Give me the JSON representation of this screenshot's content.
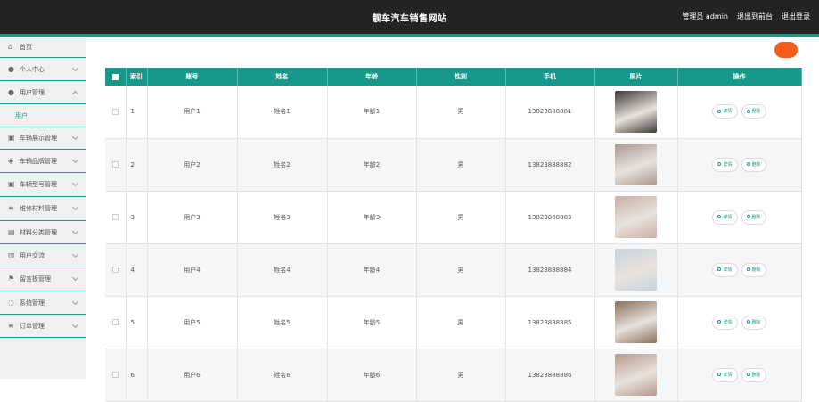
{
  "header": {
    "title": "靓车汽车销售网站",
    "admin_label": "管理员 admin",
    "backend_label": "退出到前台",
    "logout_label": "退出登录"
  },
  "sidebar": {
    "items": [
      {
        "label": "首页",
        "icon": "home-icon",
        "expanded": false,
        "has_chevron": false
      },
      {
        "label": "个人中心",
        "icon": "user-icon",
        "has_chevron": true
      },
      {
        "label": "用户管理",
        "icon": "user-icon",
        "has_chevron": true,
        "expanded": true
      },
      {
        "label": "车辆展示管理",
        "icon": "car-icon",
        "has_chevron": true
      },
      {
        "label": "车辆品牌管理",
        "icon": "tag-icon",
        "has_chevron": true
      },
      {
        "label": "车辆型号管理",
        "icon": "car-icon",
        "has_chevron": true
      },
      {
        "label": "维修材料管理",
        "icon": "list-icon",
        "has_chevron": true
      },
      {
        "label": "材料分类管理",
        "icon": "box-icon",
        "has_chevron": true
      },
      {
        "label": "用户交流",
        "icon": "chat-icon",
        "has_chevron": true
      },
      {
        "label": "留言板管理",
        "icon": "flag-icon",
        "has_chevron": true
      },
      {
        "label": "系统管理",
        "icon": "gear-icon",
        "has_chevron": true
      },
      {
        "label": "订单管理",
        "icon": "list-icon",
        "has_chevron": true
      }
    ],
    "sub_item": "用户"
  },
  "toolbar": {
    "orange_button_label": " "
  },
  "table": {
    "headers": [
      "",
      "索引",
      "账号",
      "姓名",
      "年龄",
      "性别",
      "手机",
      "照片",
      "操作"
    ],
    "rows": [
      {
        "index": "1",
        "account": "用户1",
        "name": "姓名1",
        "age": "年龄1",
        "gender": "男",
        "phone": "13823888881",
        "photo_color": "#3b3a36"
      },
      {
        "index": "2",
        "account": "用户2",
        "name": "姓名2",
        "age": "年龄2",
        "gender": "男",
        "phone": "13823888882",
        "photo_color": "#a89890"
      },
      {
        "index": "3",
        "account": "用户3",
        "name": "姓名3",
        "age": "年龄3",
        "gender": "男",
        "phone": "13823888883",
        "photo_color": "#c9b0a6"
      },
      {
        "index": "4",
        "account": "用户4",
        "name": "姓名4",
        "age": "年龄4",
        "gender": "男",
        "phone": "13823888884",
        "photo_color": "#c8d4dc"
      },
      {
        "index": "5",
        "account": "用户5",
        "name": "姓名5",
        "age": "年龄5",
        "gender": "男",
        "phone": "13823888885",
        "photo_color": "#8a6f60"
      },
      {
        "index": "6",
        "account": "用户6",
        "name": "姓名6",
        "age": "年龄6",
        "gender": "男",
        "phone": "13823888886",
        "photo_color": "#b49a8c"
      }
    ],
    "detail_label": "详情",
    "delete_label": "删除"
  },
  "colors": {
    "accent": "#16998a",
    "topbar": "#232323",
    "orange": "#f45b1b"
  }
}
